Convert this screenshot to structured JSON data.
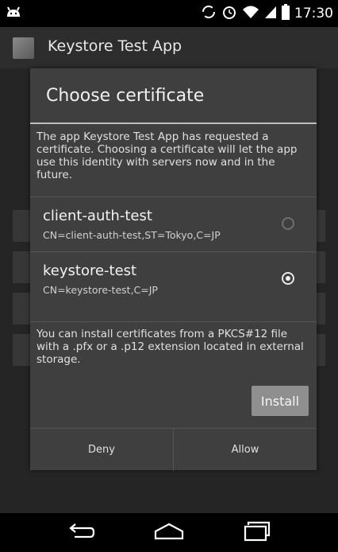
{
  "status_bar": {
    "time": "17:30",
    "icons": [
      "notification-icon",
      "sync-icon",
      "alarm-icon",
      "wifi-icon",
      "signal-icon",
      "battery-icon"
    ]
  },
  "action_bar": {
    "app_icon": "app-icon",
    "title": "Keystore Test App"
  },
  "dialog": {
    "title": "Choose certificate",
    "message": "The app Keystore Test App has requested a certificate. Choosing a certificate will let the app use this identity with servers now and in the future.",
    "certificates": [
      {
        "name": "client-auth-test",
        "subject": "CN=client-auth-test,ST=Tokyo,C=JP",
        "selected": false
      },
      {
        "name": "keystore-test",
        "subject": "CN=keystore-test,C=JP",
        "selected": true
      }
    ],
    "install_note": "You can install certificates from a PKCS#12 file with a .pfx or a .p12 extension located in external storage.",
    "install_label": "Install",
    "deny_label": "Deny",
    "allow_label": "Allow"
  },
  "nav_bar": {
    "icons": [
      "back-icon",
      "home-icon",
      "recents-icon"
    ]
  }
}
